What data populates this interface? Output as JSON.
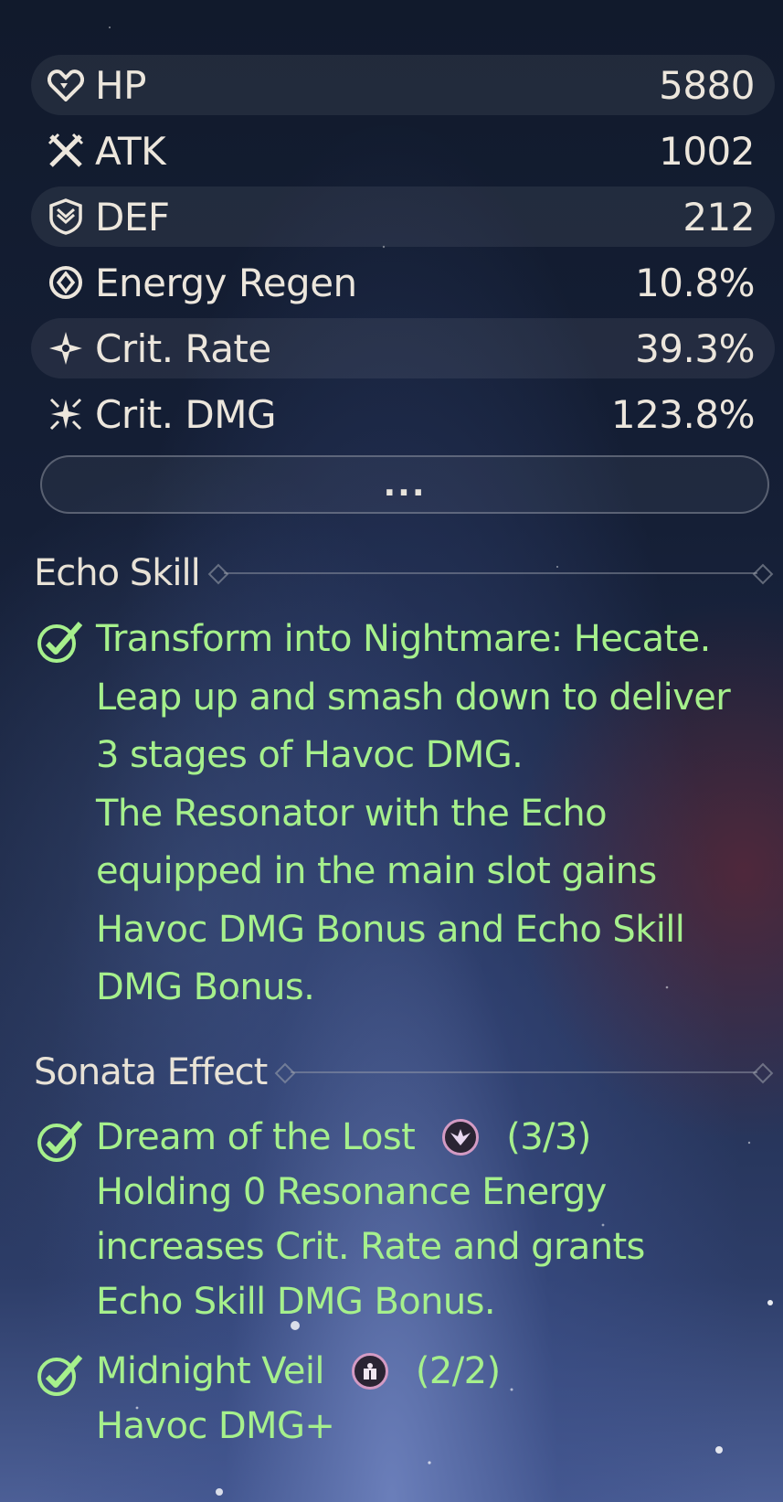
{
  "stats": [
    {
      "icon": "heart-icon",
      "label": "HP",
      "value": "5880"
    },
    {
      "icon": "sword-icon",
      "label": "ATK",
      "value": "1002"
    },
    {
      "icon": "shield-icon",
      "label": "DEF",
      "value": "212"
    },
    {
      "icon": "energy-icon",
      "label": "Energy Regen",
      "value": "10.8%"
    },
    {
      "icon": "star-icon",
      "label": "Crit. Rate",
      "value": "39.3%"
    },
    {
      "icon": "burst-icon",
      "label": "Crit. DMG",
      "value": "123.8%"
    }
  ],
  "more_button_label": "...",
  "echo_skill": {
    "heading": "Echo Skill",
    "lines": [
      "Transform into Nightmare: Hecate.",
      "Leap up and smash down to deliver",
      "3 stages of Havoc DMG.",
      "The Resonator with the Echo",
      "equipped in the main slot gains",
      "Havoc DMG Bonus and Echo Skill",
      "DMG Bonus."
    ]
  },
  "sonata": {
    "heading": "Sonata Effect",
    "effects": [
      {
        "name": "Dream of the Lost",
        "icon": "dream-sonata-icon",
        "count": "(3/3)",
        "lines": [
          "Holding 0 Resonance Energy",
          "increases Crit. Rate and grants",
          "Echo Skill DMG Bonus."
        ]
      },
      {
        "name": "Midnight Veil",
        "icon": "midnight-sonata-icon",
        "count": "(2/2)",
        "lines": [
          "Havoc DMG+"
        ]
      }
    ]
  },
  "colors": {
    "accent_green": "#a6f08c",
    "text_light": "#ece6dc",
    "sonata_ring": "#d49bc4"
  }
}
